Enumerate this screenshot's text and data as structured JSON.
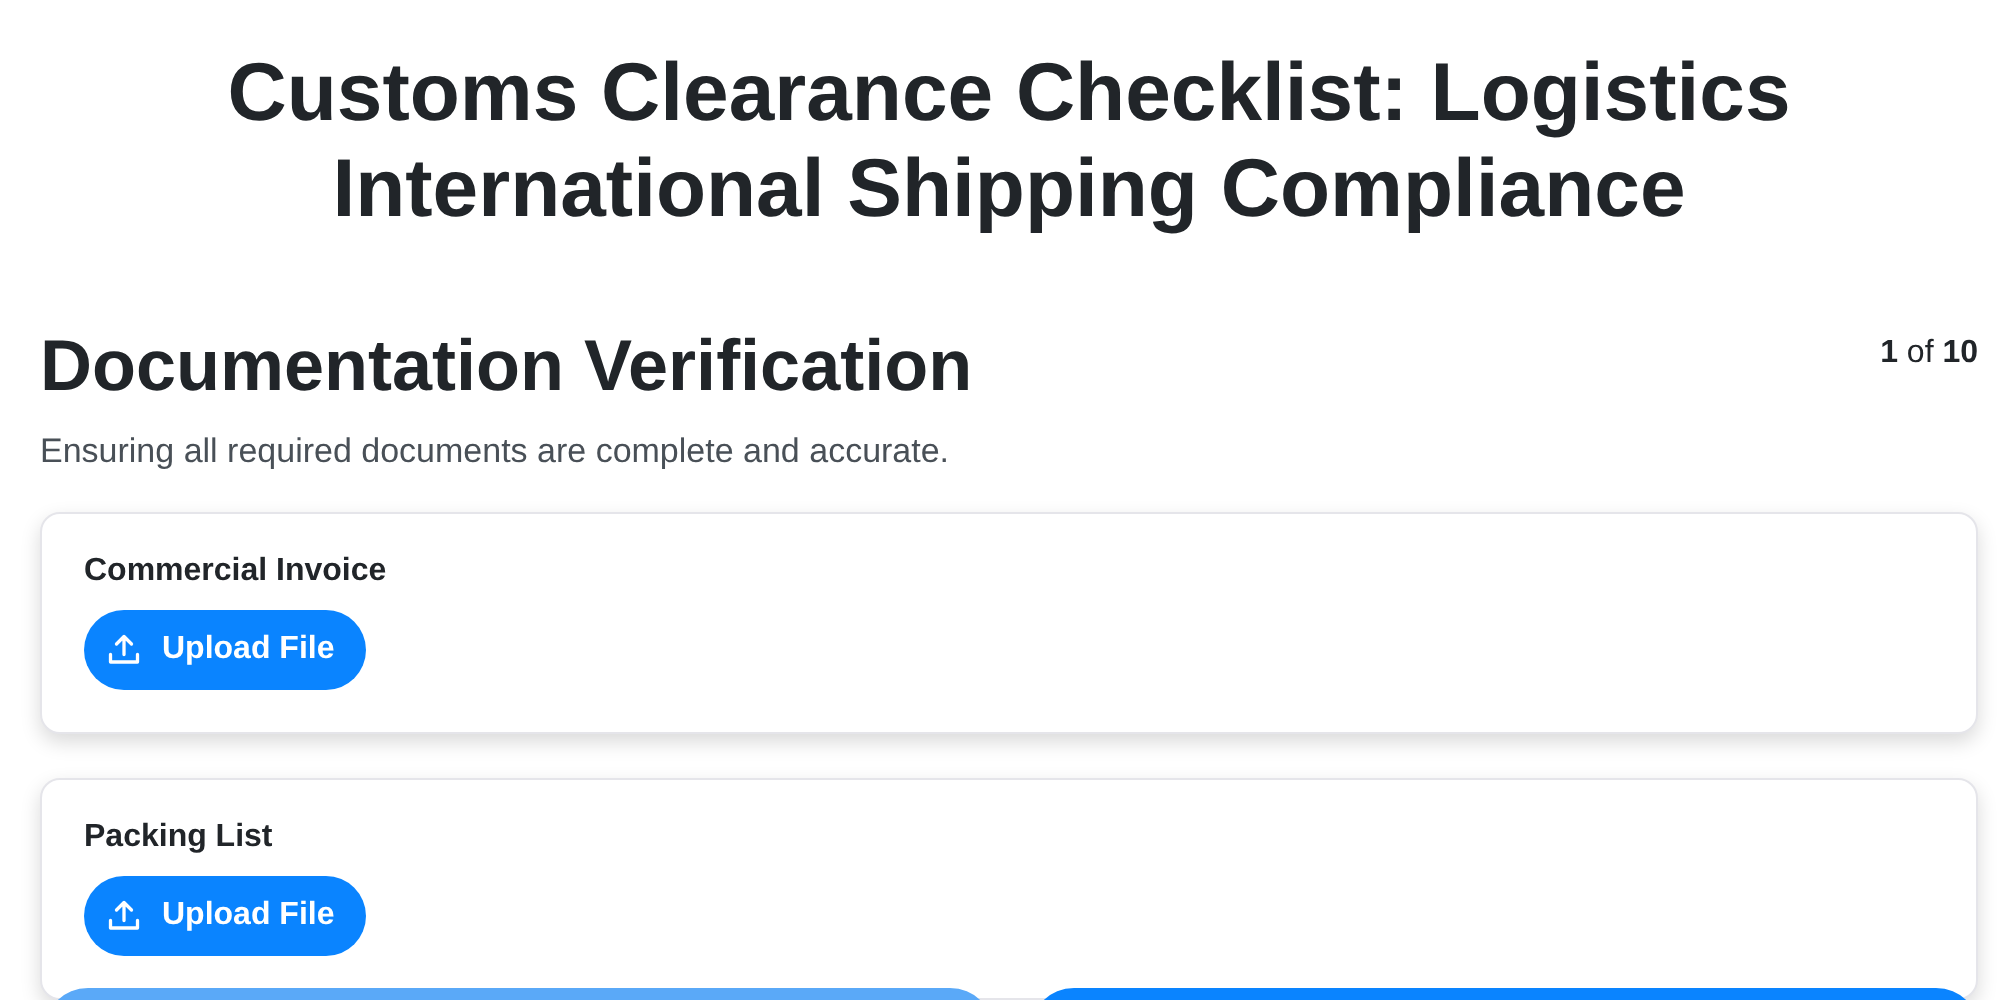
{
  "title": "Customs Clearance Checklist: Logistics International Shipping Compliance",
  "section": {
    "heading": "Documentation Verification",
    "counter": "**1** of **10**",
    "description": "Ensuring all required documents are complete and accurate."
  },
  "items": [
    {
      "label": "Commercial Invoice",
      "button": "Upload File"
    },
    {
      "label": "Packing List",
      "button": "Upload File"
    }
  ],
  "nav_buttons": [
    {
      "disabled": true
    },
    {
      "disabled": false
    }
  ]
}
